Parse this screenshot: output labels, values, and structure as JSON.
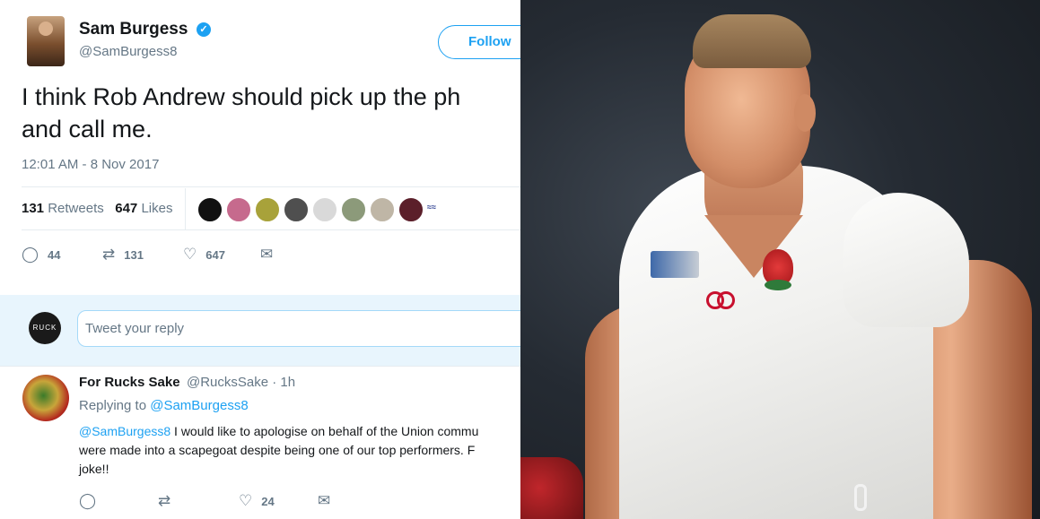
{
  "tweet": {
    "author_name": "Sam Burgess",
    "author_handle": "@SamBurgess8",
    "follow_label": "Follow",
    "text_line1": "I think Rob Andrew should pick up the ph",
    "text_line2": "and call me.",
    "timestamp": "12:01 AM - 8 Nov 2017",
    "retweets_count": "131",
    "retweets_label": "Retweets",
    "likes_count": "647",
    "likes_label": "Likes",
    "actions": {
      "reply_count": "44",
      "retweet_count": "131",
      "like_count": "647"
    }
  },
  "reply_compose": {
    "avatar_text": "RUCK",
    "placeholder": "Tweet your reply"
  },
  "reply": {
    "author_name": "For Rucks Sake",
    "author_handle": "@RucksSake · 1h",
    "replying_prefix": "Replying to",
    "replying_mention": "@SamBurgess8",
    "mention": "@SamBurgess8",
    "text_line1": " I would like to apologise on behalf of the Union commu",
    "text_line2": "were made into a scapegoat despite being one of our top performers. F",
    "text_line3": "joke!!",
    "actions": {
      "like_count": "24"
    }
  },
  "colors": {
    "accent": "#1da1f2",
    "muted_text": "#657786",
    "reply_box_bg": "#e8f5fd"
  },
  "icons": [
    "verified-icon",
    "reply-icon",
    "retweet-icon",
    "like-icon",
    "message-icon"
  ]
}
